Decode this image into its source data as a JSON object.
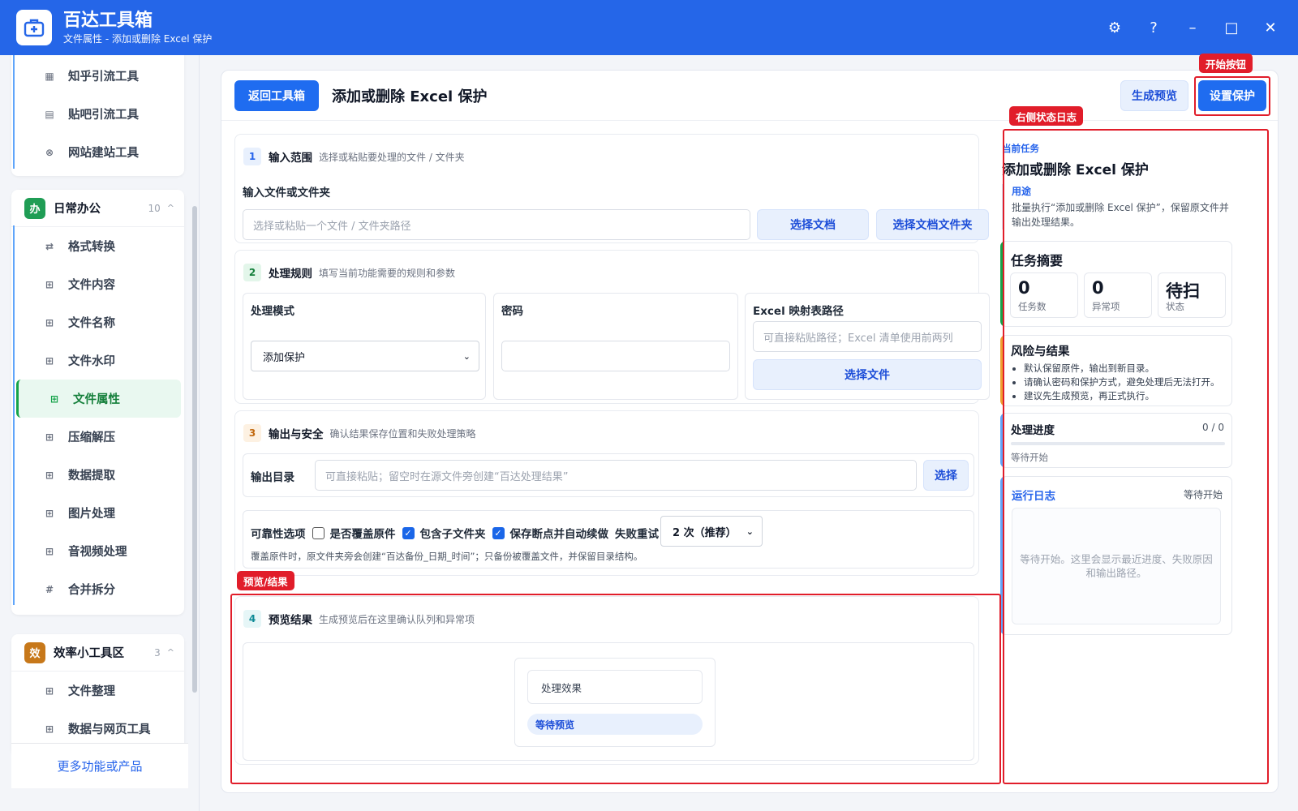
{
  "window": {
    "app_name": "百达工具箱",
    "subtitle": "文件属性 - 添加或删除 Excel 保护",
    "controls": [
      "⚙",
      "?",
      "–",
      "□",
      "✕"
    ]
  },
  "sidebar": {
    "top_items": [
      {
        "label": "知乎引流工具",
        "icon": "doc-grid-icon"
      },
      {
        "label": "贴吧引流工具",
        "icon": "doc-icon"
      },
      {
        "label": "网站建站工具",
        "icon": "globe-icon"
      }
    ],
    "groups": [
      {
        "badge": "办",
        "badge_color": "#1f9d55",
        "title": "日常办公",
        "count": "10",
        "items": [
          {
            "label": "格式转换",
            "glyph": "⇄"
          },
          {
            "label": "文件内容",
            "glyph": "⊞"
          },
          {
            "label": "文件名称",
            "glyph": "⊞"
          },
          {
            "label": "文件水印",
            "glyph": "⊞"
          },
          {
            "label": "文件属性",
            "glyph": "⊞",
            "active": true
          },
          {
            "label": "压缩解压",
            "glyph": "⊞"
          },
          {
            "label": "数据提取",
            "glyph": "⊞"
          },
          {
            "label": "图片处理",
            "glyph": "⊞"
          },
          {
            "label": "音视频处理",
            "glyph": "⊞"
          },
          {
            "label": "合并拆分",
            "glyph": "#"
          }
        ]
      },
      {
        "badge": "效",
        "badge_color": "#c7781a",
        "title": "效率小工具区",
        "count": "3",
        "items": [
          {
            "label": "文件整理",
            "glyph": "⊞"
          },
          {
            "label": "数据与网页工具",
            "glyph": "⊞"
          }
        ]
      }
    ],
    "more_link": "更多功能或产品",
    "caret": "^"
  },
  "topbar": {
    "back_button": "返回工具箱",
    "title": "添加或删除 Excel 保护",
    "preview_button": "生成预览",
    "start_button": "设置保护"
  },
  "section1": {
    "step": "1",
    "title": "输入范围",
    "desc": "选择或粘贴要处理的文件 / 文件夹",
    "field_label": "输入文件或文件夹",
    "placeholder": "选择或粘贴一个文件 / 文件夹路径",
    "btn_file": "选择文档",
    "btn_folder": "选择文档文件夹"
  },
  "section2": {
    "step": "2",
    "title": "处理规则",
    "desc": "填写当前功能需要的规则和参数",
    "mode_label": "处理模式",
    "mode_value": "添加保护",
    "password_label": "密码",
    "password_value": "",
    "mapping_label": "Excel 映射表路径",
    "mapping_placeholder": "可直接粘贴路径；Excel 清单使用前两列",
    "mapping_button": "选择文件"
  },
  "section3": {
    "step": "3",
    "title": "输出与安全",
    "desc": "确认结果保存位置和失败处理策略",
    "output_label": "输出目录",
    "output_placeholder": "可直接粘贴；留空时在源文件旁创建“百达处理结果”",
    "output_button": "选择",
    "reliability_label": "可靠性选项",
    "overwrite_label": "是否覆盖原件",
    "overwrite_checked": false,
    "subfolder_label": "包含子文件夹",
    "subfolder_checked": true,
    "resume_label": "保存断点并自动续做",
    "resume_checked": true,
    "retry_label": "失败重试",
    "retry_value": "2 次（推荐）",
    "note": "覆盖原件时，原文件夹旁会创建“百达备份_日期_时间”；只备份被覆盖文件，并保留目录结构。"
  },
  "section4": {
    "step": "4",
    "title": "预览结果",
    "desc": "生成预览后在这里确认队列和异常项",
    "effect_label": "处理效果",
    "status_pill": "等待预览"
  },
  "right_panel": {
    "current_task_label": "当前任务",
    "task_title": "添加或删除 Excel 保护",
    "usage_label": "用途",
    "usage_text": "批量执行“添加或删除 Excel 保护”，保留原文件并输出处理结果。",
    "summary_title": "任务摘要",
    "stats": [
      {
        "value": "0",
        "label": "任务数"
      },
      {
        "value": "0",
        "label": "异常项"
      },
      {
        "value": "待扫",
        "label": "状态"
      }
    ],
    "risk_title": "风险与结果",
    "risk_items": [
      "默认保留原件，输出到新目录。",
      "请确认密码和保护方式，避免处理后无法打开。",
      "建议先生成预览，再正式执行。"
    ],
    "progress_title": "处理进度",
    "progress_count": "0 / 0",
    "progress_fraction": 0,
    "progress_status": "等待开始",
    "log_title": "运行日志",
    "log_status": "等待开始",
    "log_placeholder": "等待开始。这里会显示最近进度、失败原因和输出路径。"
  },
  "annotations": {
    "start_button_tag": "开始按钮",
    "right_log_tag": "右侧状态日志",
    "preview_tag": "预览/结果"
  },
  "colors": {
    "brand": "#2566e8",
    "primary_button": "#1f6cf0",
    "annotation": "#e11d2a",
    "active_green": "#16a34a"
  }
}
